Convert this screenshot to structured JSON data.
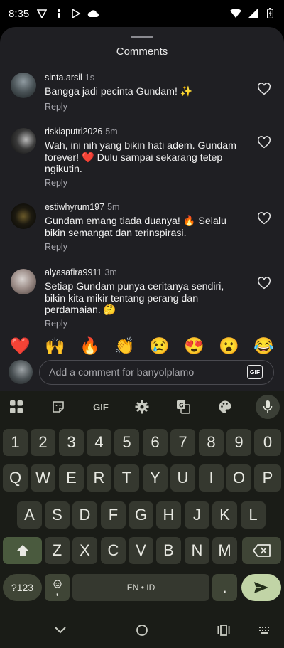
{
  "status": {
    "time": "8:35"
  },
  "sheet": {
    "title": "Comments"
  },
  "comments": [
    {
      "user": "sinta.arsil",
      "time": "1s",
      "text": "Bangga jadi pecinta Gundam! ✨",
      "reply": "Reply"
    },
    {
      "user": "riskiaputri2026",
      "time": "5m",
      "text": "Wah, ini nih yang bikin hati adem. Gundam forever! ❤️ Dulu sampai sekarang tetep ngikutin.",
      "reply": "Reply"
    },
    {
      "user": "estiwhyrum197",
      "time": "5m",
      "text": "Gundam emang tiada duanya! 🔥 Selalu bikin semangat dan terinspirasi.",
      "reply": "Reply"
    },
    {
      "user": "alyasafira9911",
      "time": "3m",
      "text": "Setiap Gundam punya ceritanya sendiri, bikin kita mikir tentang perang dan perdamaian. 🤔",
      "reply": "Reply"
    }
  ],
  "emojis": [
    "❤️",
    "🙌",
    "🔥",
    "👏",
    "😢",
    "😍",
    "😮",
    "😂"
  ],
  "composer": {
    "placeholder": "Add a comment for banyolplamo",
    "gif_label": "GIF"
  },
  "keyboard": {
    "toolbar_gif": "GIF",
    "row_numbers": [
      "1",
      "2",
      "3",
      "4",
      "5",
      "6",
      "7",
      "8",
      "9",
      "0"
    ],
    "row_top": [
      "Q",
      "W",
      "E",
      "R",
      "T",
      "Y",
      "U",
      "I",
      "O",
      "P"
    ],
    "row_mid": [
      "A",
      "S",
      "D",
      "F",
      "G",
      "H",
      "J",
      "K",
      "L"
    ],
    "row_bottom": [
      "Z",
      "X",
      "C",
      "V",
      "B",
      "N",
      "M"
    ],
    "symbols_label": "?123",
    "emoji_key_label": ",",
    "space_label": "EN • ID",
    "period_label": "."
  }
}
